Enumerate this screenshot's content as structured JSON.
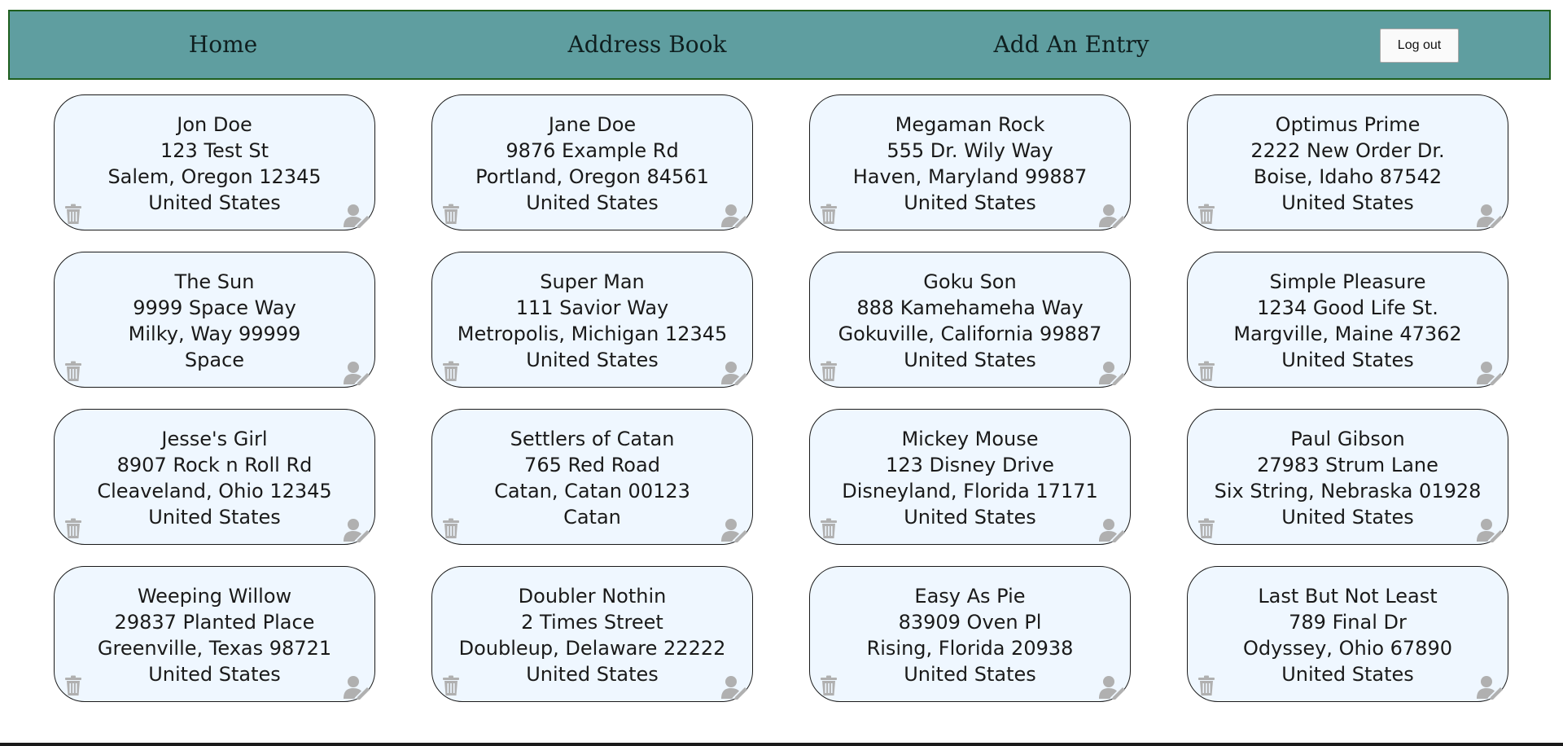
{
  "nav": {
    "home": "Home",
    "address_book": "Address Book",
    "add_entry": "Add An Entry",
    "logout": "Log out"
  },
  "colors": {
    "navbar": "#5f9ea0",
    "navbar_border": "#1e5e1e",
    "card_bg": "#eff7ff",
    "icon": "#b0b0b0"
  },
  "card_icons": {
    "left": "trash-icon",
    "right": "edit-user-icon"
  },
  "entries": [
    {
      "name": "Jon Doe",
      "street": "123 Test St",
      "city_line": "Salem, Oregon 12345",
      "country": "United States"
    },
    {
      "name": "Jane Doe",
      "street": "9876 Example Rd",
      "city_line": "Portland, Oregon 84561",
      "country": "United States"
    },
    {
      "name": "Megaman Rock",
      "street": "555 Dr. Wily Way",
      "city_line": "Haven, Maryland 99887",
      "country": "United States"
    },
    {
      "name": "Optimus Prime",
      "street": "2222 New Order Dr.",
      "city_line": "Boise, Idaho 87542",
      "country": "United States"
    },
    {
      "name": "The Sun",
      "street": "9999 Space Way",
      "city_line": "Milky, Way 99999",
      "country": "Space"
    },
    {
      "name": "Super Man",
      "street": "111 Savior Way",
      "city_line": "Metropolis, Michigan 12345",
      "country": "United States"
    },
    {
      "name": "Goku Son",
      "street": "888 Kamehameha Way",
      "city_line": "Gokuville, California 99887",
      "country": "United States"
    },
    {
      "name": "Simple Pleasure",
      "street": "1234 Good Life St.",
      "city_line": "Margville, Maine 47362",
      "country": "United States"
    },
    {
      "name": "Jesse's Girl",
      "street": "8907 Rock n Roll Rd",
      "city_line": "Cleaveland, Ohio 12345",
      "country": "United States"
    },
    {
      "name": "Settlers of Catan",
      "street": "765 Red Road",
      "city_line": "Catan, Catan 00123",
      "country": "Catan"
    },
    {
      "name": "Mickey Mouse",
      "street": "123 Disney Drive",
      "city_line": "Disneyland, Florida 17171",
      "country": "United States"
    },
    {
      "name": "Paul Gibson",
      "street": "27983 Strum Lane",
      "city_line": "Six String, Nebraska 01928",
      "country": "United States"
    },
    {
      "name": "Weeping Willow",
      "street": "29837 Planted Place",
      "city_line": "Greenville, Texas 98721",
      "country": "United States"
    },
    {
      "name": "Doubler Nothin",
      "street": "2 Times Street",
      "city_line": "Doubleup, Delaware 22222",
      "country": "United States"
    },
    {
      "name": "Easy As Pie",
      "street": "83909 Oven Pl",
      "city_line": "Rising, Florida 20938",
      "country": "United States"
    },
    {
      "name": "Last But Not Least",
      "street": "789 Final Dr",
      "city_line": "Odyssey, Ohio 67890",
      "country": "United States"
    }
  ]
}
